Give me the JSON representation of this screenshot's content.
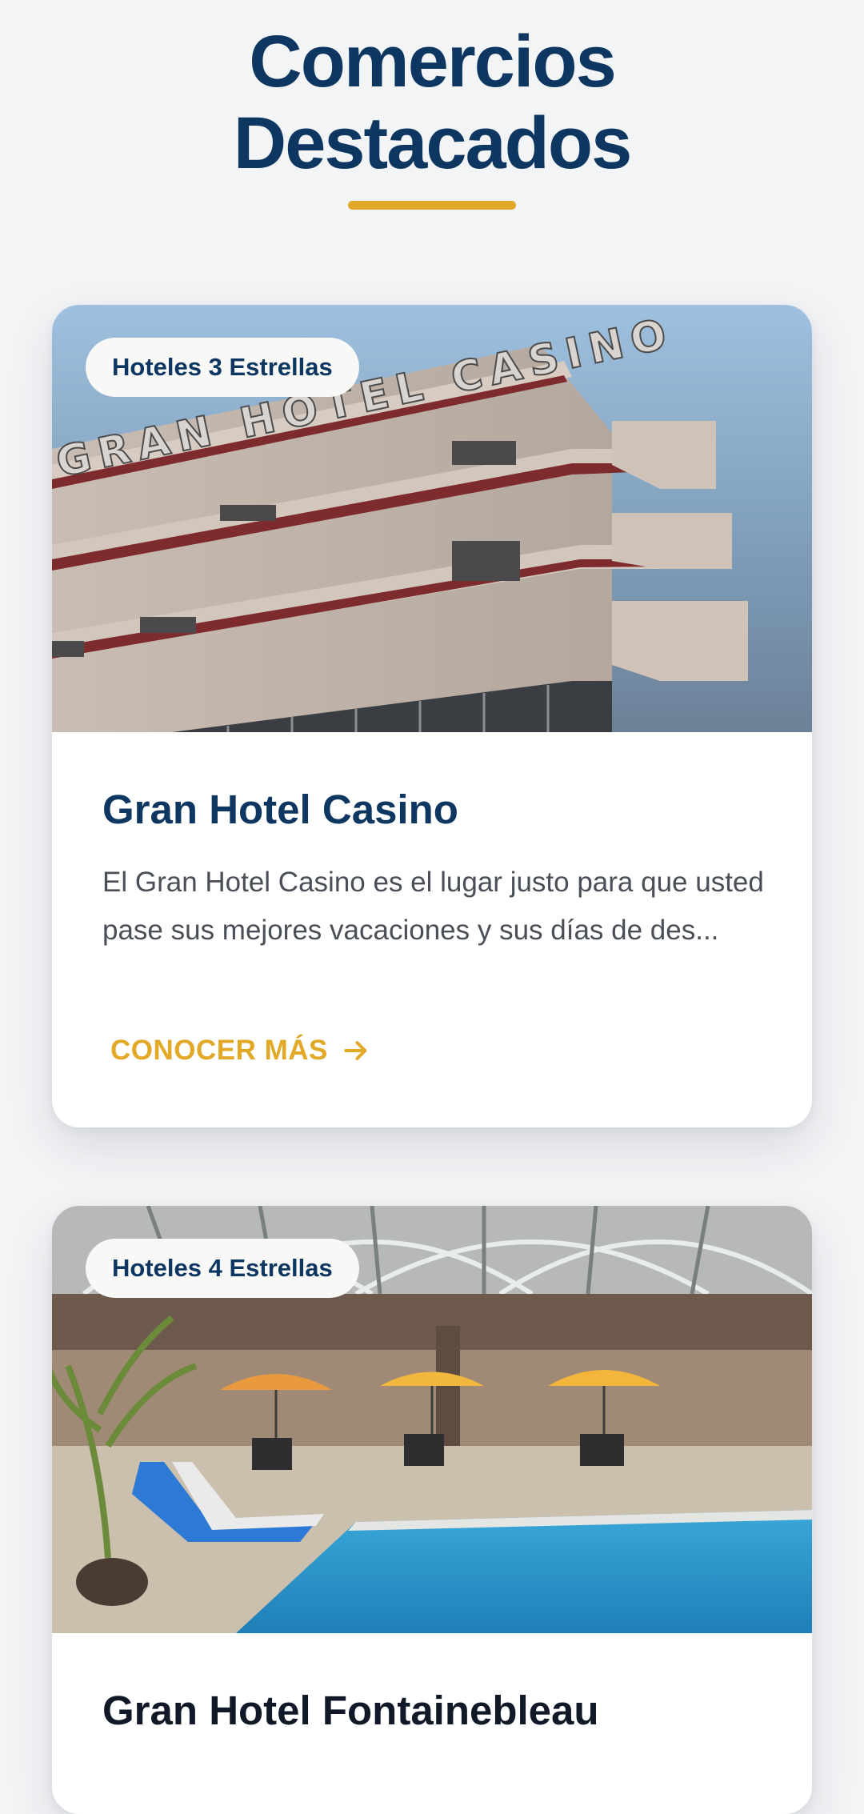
{
  "section": {
    "title_line1": "Comercios",
    "title_line2": "Destacados",
    "accent_color": "#e2a928",
    "title_color": "#0d3660"
  },
  "cards": [
    {
      "category": "Hoteles 3 Estrellas",
      "name": "Gran Hotel Casino",
      "description": "El Gran Hotel Casino es el lugar justo para que usted pase sus mejores vacaciones y sus días de des...",
      "link_label": "CONOCER MÁS",
      "link_icon": "arrow-right-icon",
      "image_sign_text": "GRAN HOTEL CASINO"
    },
    {
      "category": "Hoteles 4 Estrellas",
      "name": "Gran Hotel Fontainebleau"
    }
  ]
}
